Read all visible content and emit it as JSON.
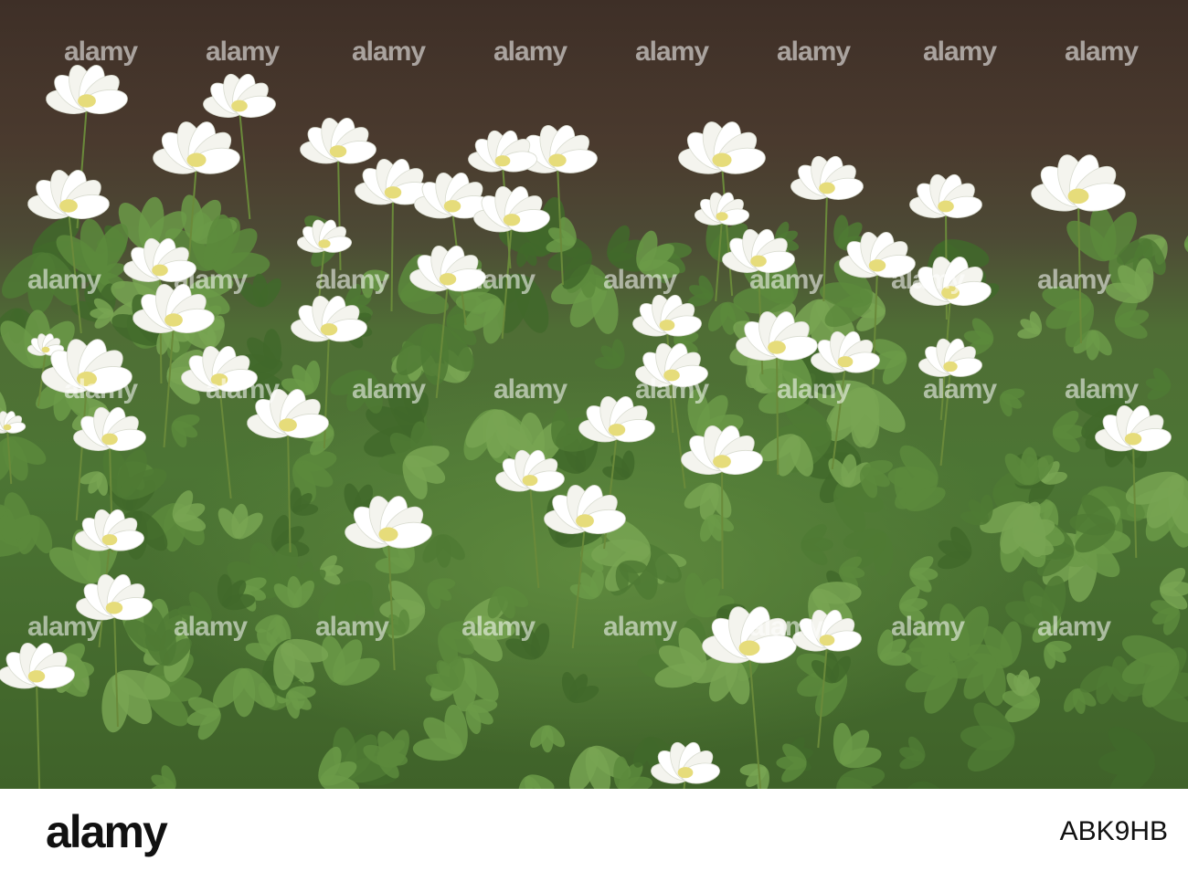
{
  "photo": {
    "subject": "wood anemone flowers",
    "colors": {
      "petal": "#f4f4ee",
      "stamen": "#e6dc7a",
      "leaf": "#4f7a34",
      "soil": "#3e2f27"
    }
  },
  "watermark": {
    "text": "alamy"
  },
  "footer": {
    "logo": "alamy",
    "image_id": "ABK9HB"
  }
}
